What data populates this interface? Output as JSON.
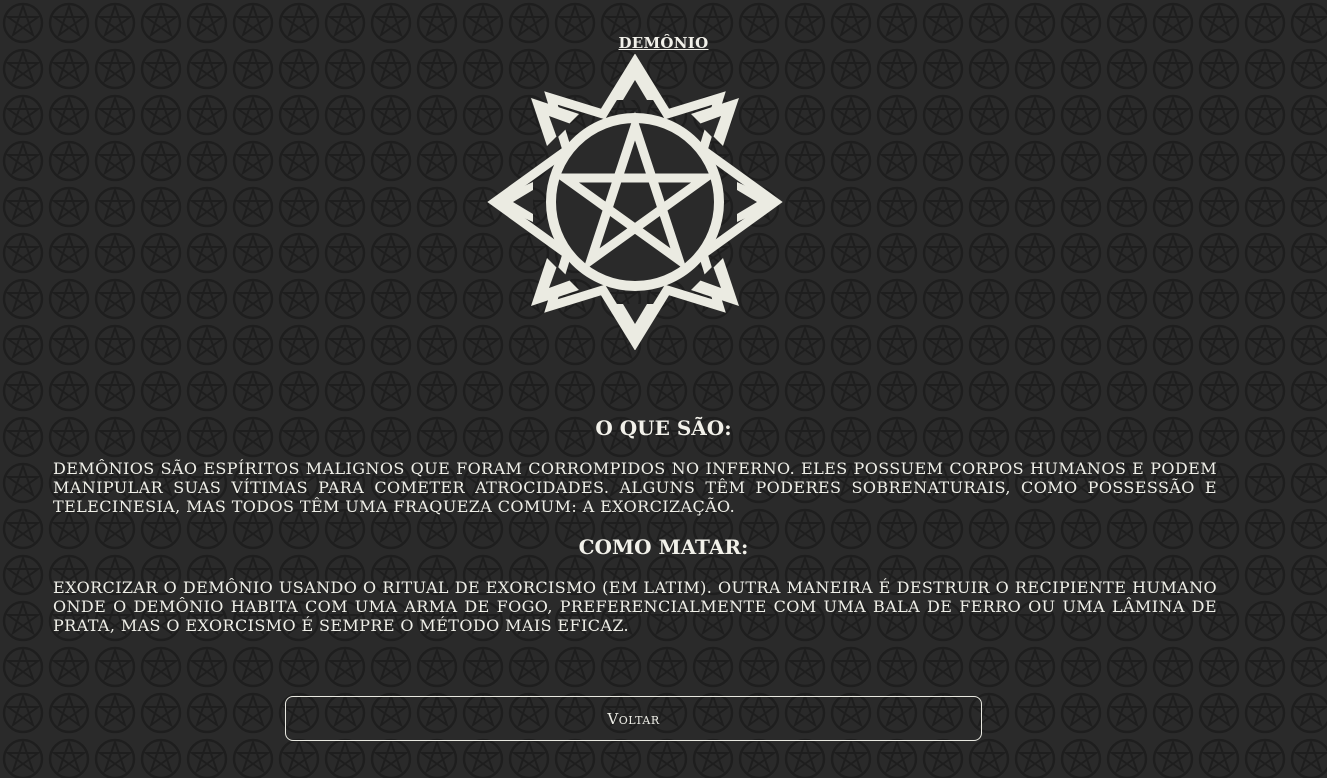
{
  "page": {
    "title": "DEMÔNIO"
  },
  "emblem": {
    "icon": "devils-trap-pentagram-icon",
    "color": "#ebebe2"
  },
  "sections": [
    {
      "heading": "O QUE SÃO:",
      "text": "Demônios são espíritos malignos que foram corrompidos no Inferno. Eles possuem corpos humanos e podem manipular suas vítimas para cometer atrocidades. Alguns têm poderes sobrenaturais, como possessão e telecinesia, mas todos têm uma fraqueza comum: a exorcização."
    },
    {
      "heading": "COMO MATAR:",
      "text": "Exorcizar o demônio usando o ritual de exorcismo (em latim). Outra maneira é destruir o recipiente humano onde o demônio habita com uma arma de fogo, preferencialmente com uma bala de ferro ou uma lâmina de prata, mas o exorcismo é sempre o método mais eficaz."
    }
  ],
  "back_button": {
    "label": "Voltar"
  },
  "colors": {
    "background": "#2a2a2a",
    "pattern": "#1f1f1f",
    "text": "#efefe8"
  }
}
